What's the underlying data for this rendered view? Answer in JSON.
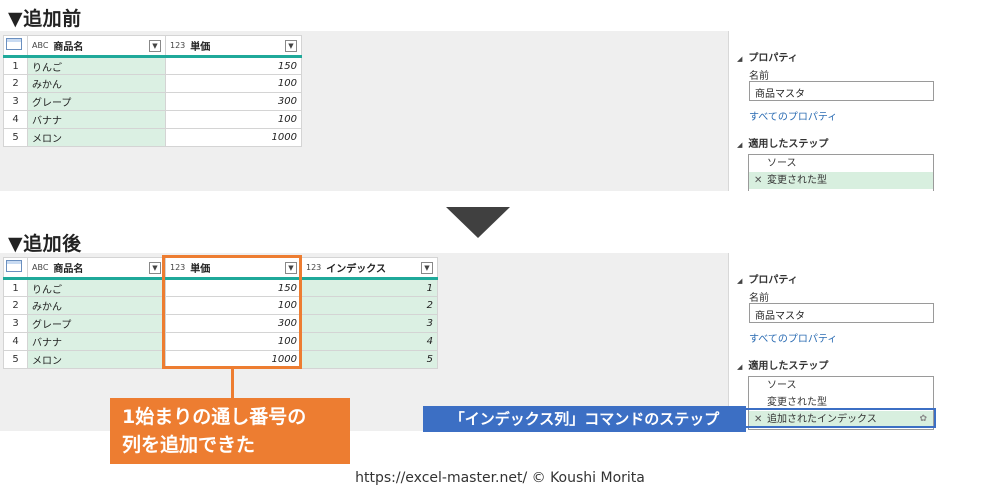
{
  "before": {
    "title": "▼追加前",
    "columns": [
      {
        "type_icon": "ABC",
        "label": "商品名"
      },
      {
        "type_icon": "123",
        "label": "単価"
      }
    ],
    "rows": [
      {
        "num": "1",
        "name": "りんご",
        "price": "150"
      },
      {
        "num": "2",
        "name": "みかん",
        "price": "100"
      },
      {
        "num": "3",
        "name": "グレープ",
        "price": "300"
      },
      {
        "num": "4",
        "name": "バナナ",
        "price": "100"
      },
      {
        "num": "5",
        "name": "メロン",
        "price": "1000"
      }
    ],
    "side": {
      "properties_heading": "プロパティ",
      "name_label": "名前",
      "name_value": "商品マスタ",
      "all_props_link": "すべてのプロパティ",
      "steps_heading": "適用したステップ",
      "steps": [
        "ソース",
        "変更された型"
      ]
    }
  },
  "after": {
    "title": "▼追加後",
    "columns": [
      {
        "type_icon": "ABC",
        "label": "商品名"
      },
      {
        "type_icon": "123",
        "label": "単価"
      },
      {
        "type_icon": "123",
        "label": "インデックス"
      }
    ],
    "rows": [
      {
        "num": "1",
        "name": "りんご",
        "price": "150",
        "index": "1"
      },
      {
        "num": "2",
        "name": "みかん",
        "price": "100",
        "index": "2"
      },
      {
        "num": "3",
        "name": "グレープ",
        "price": "300",
        "index": "3"
      },
      {
        "num": "4",
        "name": "バナナ",
        "price": "100",
        "index": "4"
      },
      {
        "num": "5",
        "name": "メロン",
        "price": "1000",
        "index": "5"
      }
    ],
    "side": {
      "properties_heading": "プロパティ",
      "name_label": "名前",
      "name_value": "商品マスタ",
      "all_props_link": "すべてのプロパティ",
      "steps_heading": "適用したステップ",
      "steps": [
        "ソース",
        "変更された型",
        "追加されたインデックス"
      ]
    }
  },
  "annotations": {
    "orange_line1": "1始まりの通し番号の",
    "orange_line2": "列を追加できた",
    "blue_label": "「インデックス列」コマンドのステップ"
  },
  "footer": "https://excel-master.net/ © Koushi Morita",
  "colors": {
    "accent_orange": "#ed7d31",
    "accent_blue": "#3c6fc4",
    "column_highlight": "#dbf0e3",
    "header_underline": "#1fa99a"
  }
}
